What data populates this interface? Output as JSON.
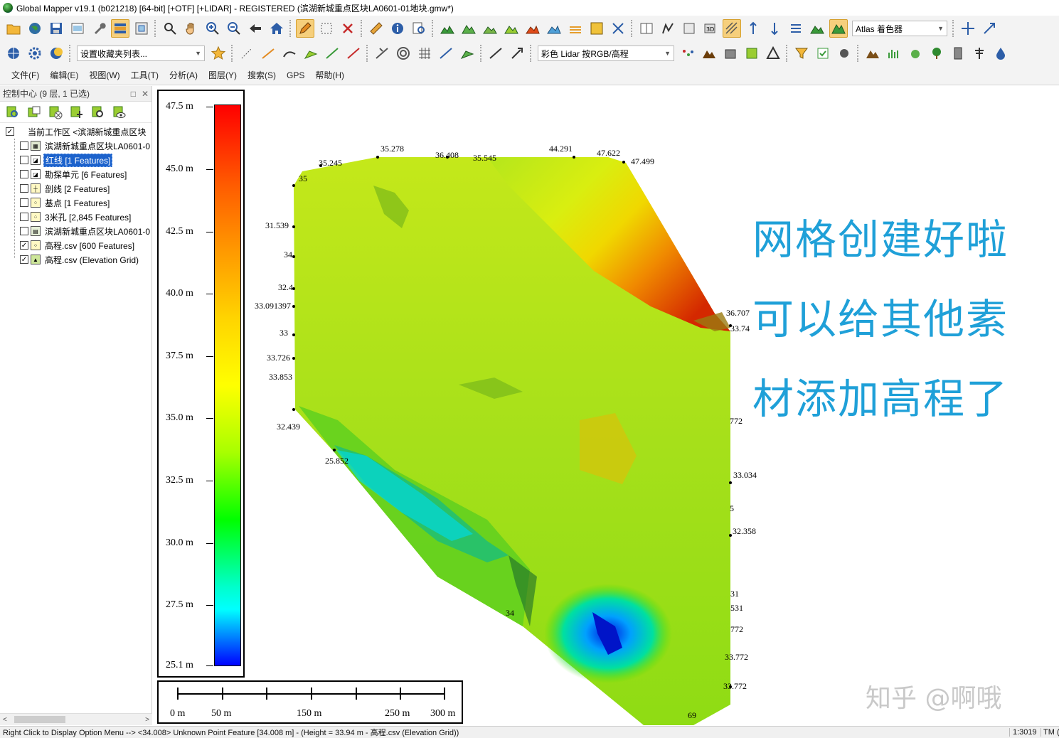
{
  "window": {
    "title": "Global Mapper v19.1 (b021218) [64-bit] [+OTF] [+LIDAR] - REGISTERED (滨湖新城重点区块LA0601-01地块.gmw*)"
  },
  "toolbar1": {
    "shader_combo": "Atlas 着色器"
  },
  "toolbar2": {
    "favorites_combo": "设置收藏夹列表...",
    "lidar_combo": "彩色 Lidar 按RGB/高程"
  },
  "menu": [
    "文件(F)",
    "编辑(E)",
    "视图(W)",
    "工具(T)",
    "分析(A)",
    "图层(Y)",
    "搜索(S)",
    "GPS",
    "帮助(H)"
  ],
  "control_center": {
    "title": "控制中心 (9 层, 1 已选)",
    "root": "当前工作区 <滨湖新城重点区块",
    "layers": [
      {
        "label": "滨湖新城重点区块LA0601-0",
        "checked": false,
        "selected": false
      },
      {
        "label": "红线 [1 Features]",
        "checked": false,
        "selected": true
      },
      {
        "label": "勘探单元 [6 Features]",
        "checked": false,
        "selected": false
      },
      {
        "label": "剖线 [2 Features]",
        "checked": false,
        "selected": false
      },
      {
        "label": "基点 [1 Features]",
        "checked": false,
        "selected": false
      },
      {
        "label": "3米孔 [2,845 Features]",
        "checked": false,
        "selected": false
      },
      {
        "label": "滨湖新城重点区块LA0601-0",
        "checked": false,
        "selected": false
      },
      {
        "label": "高程.csv [600 Features]",
        "checked": true,
        "selected": false
      },
      {
        "label": "高程.csv (Elevation Grid)",
        "checked": true,
        "selected": false
      }
    ]
  },
  "legend": {
    "labels": [
      "47.5 m",
      "45.0 m",
      "42.5 m",
      "40.0 m",
      "37.5 m",
      "35.0 m",
      "32.5 m",
      "30.0 m",
      "27.5 m",
      "25.1 m"
    ],
    "colors": [
      "#ff0000",
      "#ff9900",
      "#ffff00",
      "#00ff00",
      "#00ffff",
      "#0000ff"
    ]
  },
  "scalebar": {
    "labels": [
      "0 m",
      "50 m",
      "150 m",
      "250 m",
      "300 m"
    ]
  },
  "point_labels": [
    "35.278",
    "36.408",
    "35.545",
    "44.291",
    "47.622",
    "47.499",
    "35.245",
    "35",
    "31.539",
    "34",
    "32.4",
    "33.091397",
    "33",
    "33.726",
    "33.853",
    "32.439",
    "25.852",
    "36.707",
    "33.74",
    "772",
    "33.034",
    "5",
    "32.358",
    "31",
    "531",
    "772",
    "33.772",
    "33.772",
    "34",
    "69"
  ],
  "caption": [
    "网格创建好啦",
    "可以给其他素",
    "材添加高程了"
  ],
  "watermark": "知乎 @啊哦",
  "status": {
    "text": "Right Click to Display Option Menu --> <34.008> Unknown Point Feature [34.008 m] - (Height = 33.94 m - 高程.csv (Elevation Grid))",
    "scale": "1:3019",
    "projection": "TM (V"
  }
}
